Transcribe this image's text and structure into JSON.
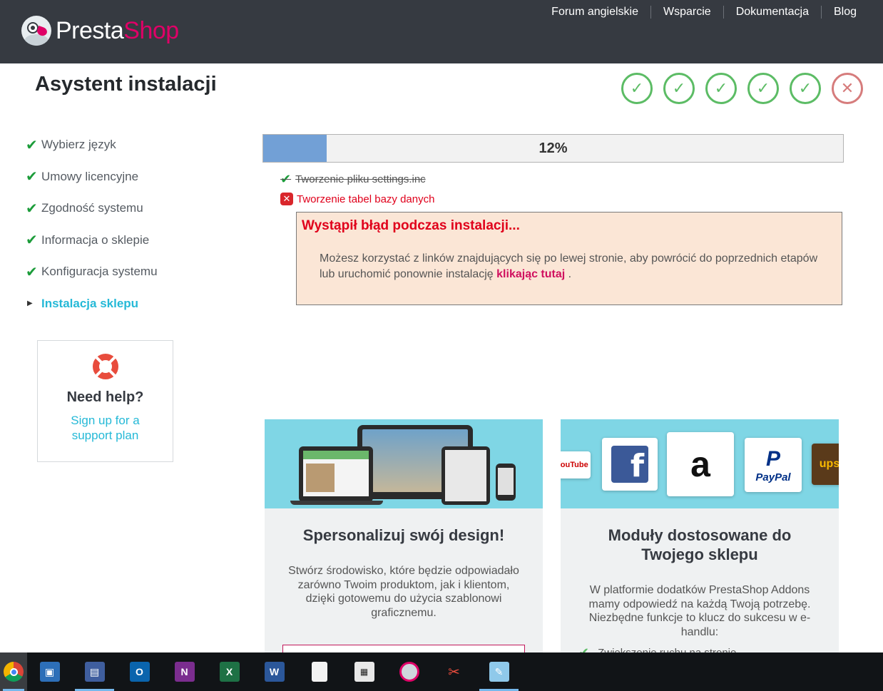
{
  "header": {
    "logo_part1": "Presta",
    "logo_part2": "Shop",
    "nav": [
      "Forum angielskie",
      "Wsparcie",
      "Dokumentacja",
      "Blog"
    ]
  },
  "page_title": "Asystent instalacji",
  "step_states": [
    "done",
    "done",
    "done",
    "done",
    "done",
    "error"
  ],
  "sidebar": {
    "items": [
      {
        "label": "Wybierz język",
        "state": "done"
      },
      {
        "label": "Umowy licencyjne",
        "state": "done"
      },
      {
        "label": "Zgodność systemu",
        "state": "done"
      },
      {
        "label": "Informacja o sklepie",
        "state": "done"
      },
      {
        "label": "Konfiguracja systemu",
        "state": "done"
      },
      {
        "label": "Instalacja sklepu",
        "state": "active"
      }
    ],
    "help": {
      "title": "Need help?",
      "link": "Sign up for a support plan"
    }
  },
  "progress": {
    "percent_text": "12%",
    "fraction": 0.11
  },
  "tasks": [
    {
      "label": "Tworzenie pliku settings.inc",
      "state": "done"
    },
    {
      "label": "Tworzenie tabel bazy danych",
      "state": "error"
    }
  ],
  "error": {
    "title": "Wystąpił błąd podczas instalacji...",
    "message": "Możesz korzystać z linków znajdujących się po lewej stronie, aby powrócić do poprzednich etapów lub uruchomić ponownie instalację",
    "link": "klikając tutaj",
    "suffix": " ."
  },
  "cards": [
    {
      "title": "Spersonalizuj swój design!",
      "description": "Stwórz środowisko, które będzie odpowiadało zarówno Twoim produktom, jak i klientom, dzięki gotowemu do użycia szablonowi graficznemu."
    },
    {
      "title": "Moduły dostosowane do Twojego sklepu",
      "description": "W platformie dodatków PrestaShop Addons mamy odpowiedź na każdą Twoją potrzebę. Niezbędne funkcje to klucz do sukcesu w e-handlu:",
      "checklist_item": "Zwiększenie ruchu na stronie"
    }
  ],
  "taskbar": {
    "apps": [
      "chrome-icon",
      "network-icon",
      "save-icon",
      "outlook-icon",
      "onenote-icon",
      "excel-icon",
      "word-icon",
      "file-icon",
      "calculator-icon",
      "app-icon",
      "paint-icon",
      "notepad-icon"
    ]
  },
  "colors": {
    "header_bg": "#363a41",
    "brand_pink": "#df0067",
    "accent_cyan": "#25b9d7",
    "success_green": "#5cbc65",
    "error_red": "#e0001b"
  }
}
